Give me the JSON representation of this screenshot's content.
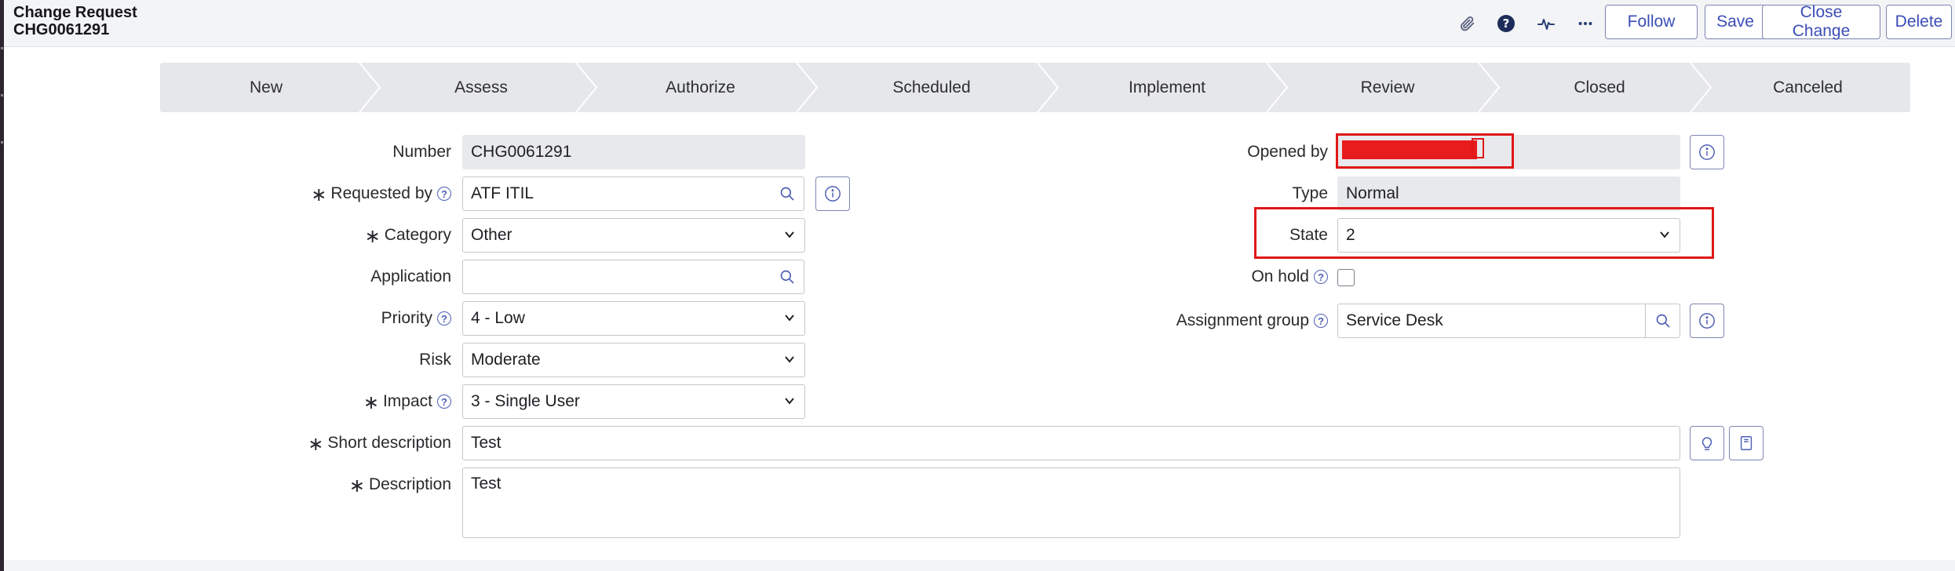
{
  "header": {
    "title_line1": "Change Request",
    "title_line2": "CHG0061291",
    "icons": [
      "paperclip-icon",
      "help-icon",
      "activity-icon",
      "more-icon"
    ],
    "buttons": {
      "follow": "Follow",
      "save": "Save",
      "close_change": "Close Change",
      "delete": "Delete"
    }
  },
  "process_flow": {
    "stages": [
      "New",
      "Assess",
      "Authorize",
      "Scheduled",
      "Implement",
      "Review",
      "Closed",
      "Canceled"
    ]
  },
  "form": {
    "number": {
      "label": "Number",
      "value": "CHG0061291"
    },
    "requested_by": {
      "label": "Requested by",
      "value": "ATF ITIL"
    },
    "category": {
      "label": "Category",
      "value": "Other"
    },
    "application": {
      "label": "Application",
      "value": ""
    },
    "priority": {
      "label": "Priority",
      "value": "4 - Low"
    },
    "risk": {
      "label": "Risk",
      "value": "Moderate"
    },
    "impact": {
      "label": "Impact",
      "value": "3 - Single User"
    },
    "short_description": {
      "label": "Short description",
      "value": "Test"
    },
    "description": {
      "label": "Description",
      "value": "Test"
    },
    "opened_by": {
      "label": "Opened by",
      "value": ""
    },
    "type": {
      "label": "Type",
      "value": "Normal"
    },
    "state": {
      "label": "State",
      "value": "2"
    },
    "on_hold": {
      "label": "On hold",
      "checked": false
    },
    "assignment_group": {
      "label": "Assignment group",
      "value": "Service Desk"
    },
    "required_marker": "∗"
  },
  "colors": {
    "accent": "#3b4db6",
    "highlight": "#e01818",
    "header_bg": "#f3f4f6",
    "flow_bg": "#e6e7ea"
  }
}
